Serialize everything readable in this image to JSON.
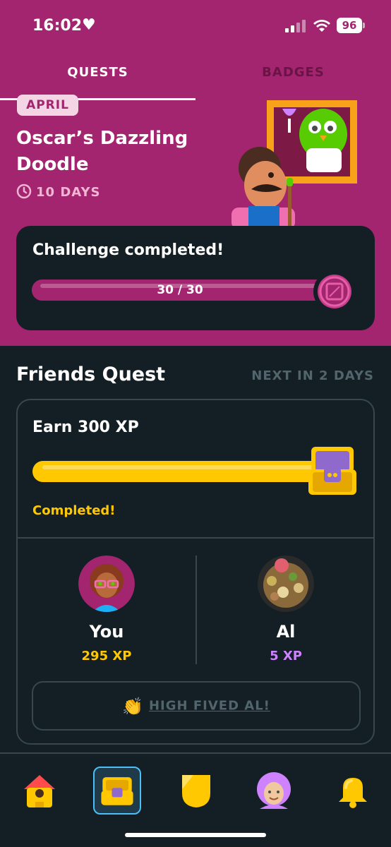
{
  "status_bar": {
    "time": "16:02",
    "battery": "96"
  },
  "tabs": [
    {
      "label": "QUESTS",
      "active": true
    },
    {
      "label": "BADGES",
      "active": false
    }
  ],
  "monthly": {
    "month": "APRIL",
    "title": "Oscar’s Dazzling Doodle",
    "time_left": "10 DAYS",
    "status": "Challenge completed!",
    "progress_text": "30 / 30",
    "progress_fraction": 1.0
  },
  "friends_quest": {
    "title": "Friends Quest",
    "next": "NEXT IN 2 DAYS",
    "goal": "Earn 300 XP",
    "progress_fraction": 1.0,
    "status": "Completed!",
    "friends": [
      {
        "name": "You",
        "xp": "295 XP"
      },
      {
        "name": "Al",
        "xp": "5 XP"
      }
    ],
    "high_five_label": "HIGH FIVED AL!"
  },
  "nav": [
    {
      "icon": "home-icon"
    },
    {
      "icon": "quests-chest-icon",
      "active": true
    },
    {
      "icon": "leaderboard-shield-icon"
    },
    {
      "icon": "profile-avatar-icon"
    },
    {
      "icon": "notifications-bell-icon"
    }
  ],
  "colors": {
    "accent": "#a3246f",
    "background": "#131f24",
    "gold": "#ffc800",
    "purple": "#ce82ff"
  }
}
